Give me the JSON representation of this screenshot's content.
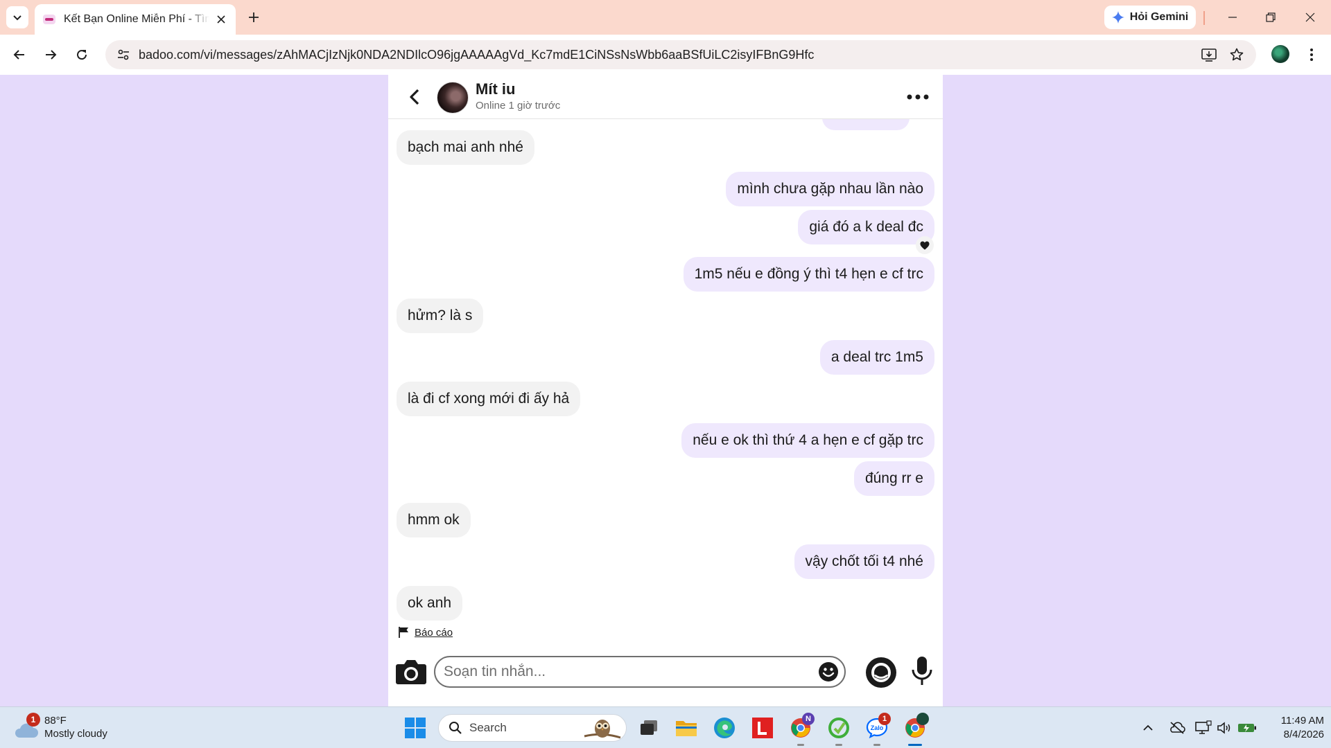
{
  "browser": {
    "tab_title": "Kết Bạn Online Miễn Phí - Tìm Bạn",
    "url": "badoo.com/vi/messages/zAhMACjIzNjk0NDA2NDIlcO96jgAAAAAgVd_Kc7mdE1CiNSsNsWbb6aaBSfUiLC2isyIFBnG9Hfc",
    "gemini_label": "Hỏi Gemini"
  },
  "chat": {
    "contact_name": "Mít iu",
    "contact_status": "Online 1 giờ trước",
    "messages": [
      {
        "side": "in",
        "text": "bạch mai anh nhé"
      },
      {
        "side": "out",
        "text": "mình chưa gặp nhau lần nào"
      },
      {
        "side": "out",
        "text": "giá đó a k deal đc",
        "reaction": "heart"
      },
      {
        "side": "out",
        "text": "1m5 nếu e đồng ý thì t4 hẹn e cf trc"
      },
      {
        "side": "in",
        "text": "hửm? là s"
      },
      {
        "side": "out",
        "text": "a deal trc 1m5"
      },
      {
        "side": "in",
        "text": "là đi cf xong mới đi ấy hả"
      },
      {
        "side": "out",
        "text": "nếu e ok thì thứ 4 a hẹn e cf gặp trc"
      },
      {
        "side": "out",
        "text": "đúng rr e"
      },
      {
        "side": "in",
        "text": "hmm ok"
      },
      {
        "side": "out",
        "text": "vậy chốt tối t4 nhé"
      },
      {
        "side": "in",
        "text": "ok anh"
      }
    ],
    "report_label": "Báo cáo",
    "input_placeholder": "Soạn tin nhắn..."
  },
  "taskbar": {
    "weather_temp": "88°F",
    "weather_desc": "Mostly cloudy",
    "weather_badge": "1",
    "search_label": "Search",
    "zalo_badge": "1",
    "chrome_profile_badge": "N",
    "time": "11:49 AM",
    "date": "8/4/2026"
  },
  "colors": {
    "page_bg": "#e5dafb",
    "tab_strip": "#fbd9cd",
    "outgoing_bubble": "#efe8fd",
    "incoming_bubble": "#f2f2f2"
  }
}
